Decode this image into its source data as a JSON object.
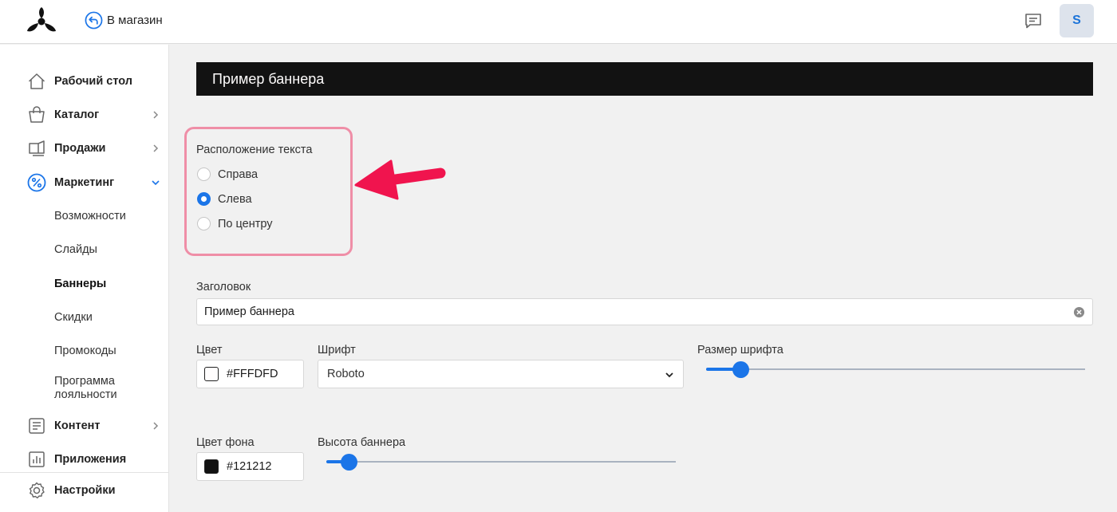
{
  "topbar": {
    "store_link_label": "В магазин",
    "user_initial": "S"
  },
  "sidebar": {
    "items": [
      {
        "label": "Рабочий стол",
        "icon": "home-icon"
      },
      {
        "label": "Каталог",
        "icon": "bag-icon"
      },
      {
        "label": "Продажи",
        "icon": "sales-icon"
      },
      {
        "label": "Маркетинг",
        "icon": "percent-icon",
        "expanded": true
      },
      {
        "label": "Контент",
        "icon": "document-icon"
      },
      {
        "label": "Приложения",
        "icon": "chart-icon"
      },
      {
        "label": "Настройки",
        "icon": "gear-icon"
      }
    ],
    "marketing_subitems": [
      "Возможности",
      "Слайды",
      "Баннеры",
      "Скидки",
      "Промокоды",
      "Программа лояльности"
    ],
    "active_subitem": "Баннеры"
  },
  "preview": {
    "title": "Пример баннера",
    "background": "#121212",
    "text_color": "#FFFDFD"
  },
  "text_position": {
    "label": "Расположение текста",
    "options": [
      "Справа",
      "Слева",
      "По центру"
    ],
    "selected": "Слева"
  },
  "heading": {
    "label": "Заголовок",
    "value": "Пример баннера"
  },
  "color": {
    "label": "Цвет",
    "value": "#FFFDFD"
  },
  "font": {
    "label": "Шрифт",
    "value": "Roboto"
  },
  "font_size": {
    "label": "Размер шрифта",
    "level": 0.09
  },
  "background_color": {
    "label": "Цвет фона",
    "value": "#121212"
  },
  "banner_height": {
    "label": "Высота баннера",
    "level": 0.065
  },
  "colors": {
    "accent": "#1b75e8",
    "highlight": "#ef8ea7",
    "arrow": "#f0144e"
  }
}
